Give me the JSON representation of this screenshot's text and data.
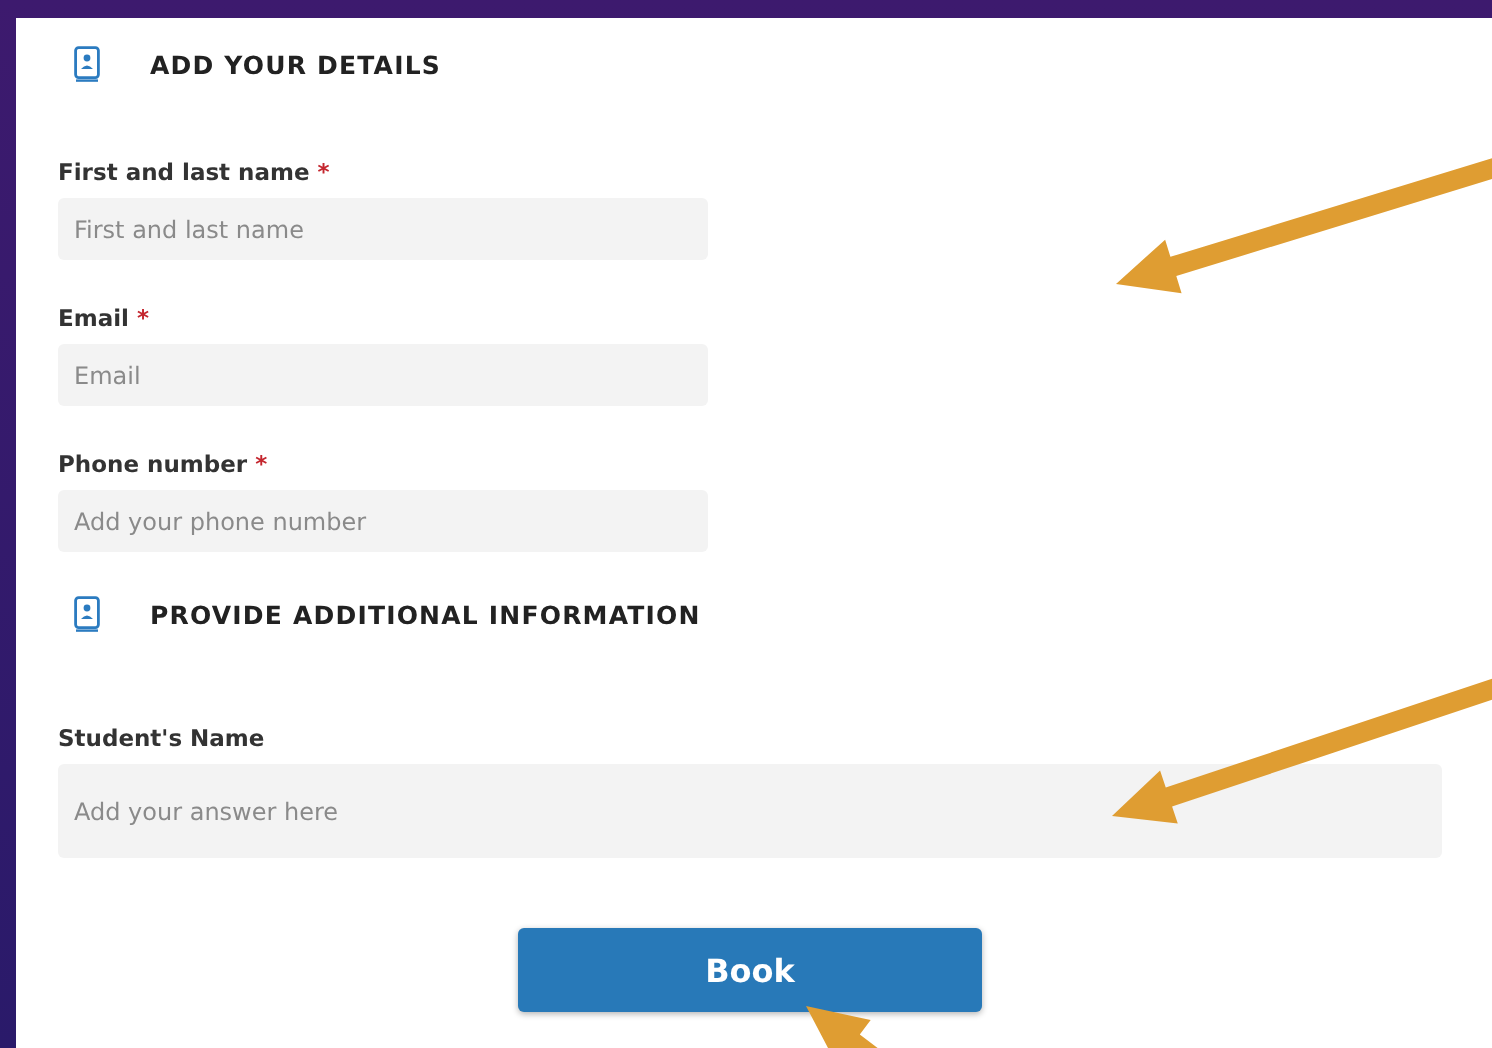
{
  "sections": [
    {
      "title": "ADD YOUR DETAILS",
      "fields": [
        {
          "label": "First and last name",
          "required_mark": "*",
          "placeholder": "First and last name",
          "kind": "short"
        },
        {
          "label": "Email",
          "required_mark": "*",
          "placeholder": "Email",
          "kind": "short"
        },
        {
          "label": "Phone number",
          "required_mark": "*",
          "placeholder": "Add your phone number",
          "kind": "short"
        }
      ]
    },
    {
      "title": "PROVIDE ADDITIONAL INFORMATION",
      "fields": [
        {
          "label": "Student's Name",
          "placeholder": "Add your answer here",
          "kind": "long"
        }
      ]
    }
  ],
  "submit": {
    "label": "Book"
  }
}
